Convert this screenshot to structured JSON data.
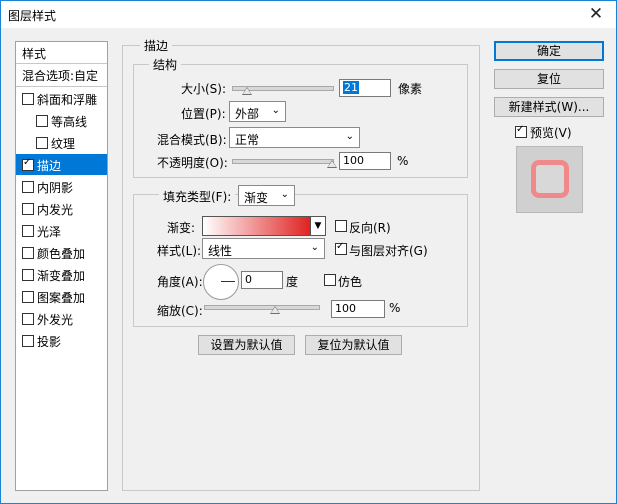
{
  "window": {
    "title": "图层样式",
    "close_glyph": "✕"
  },
  "sidebar": {
    "header": "样式",
    "blend_options": "混合选项:自定",
    "items": [
      {
        "label": "斜面和浮雕",
        "checked": false
      },
      {
        "label": "等高线",
        "checked": false
      },
      {
        "label": "纹理",
        "checked": false
      },
      {
        "label": "描边",
        "checked": true
      },
      {
        "label": "内阴影",
        "checked": false
      },
      {
        "label": "内发光",
        "checked": false
      },
      {
        "label": "光泽",
        "checked": false
      },
      {
        "label": "颜色叠加",
        "checked": false
      },
      {
        "label": "渐变叠加",
        "checked": false
      },
      {
        "label": "图案叠加",
        "checked": false
      },
      {
        "label": "外发光",
        "checked": false
      },
      {
        "label": "投影",
        "checked": false
      }
    ]
  },
  "stroke": {
    "title": "描边",
    "structure_title": "结构",
    "size_label": "大小(S):",
    "size_value": "21",
    "size_unit": "像素",
    "size_level": 0.15,
    "position_label": "位置(P):",
    "position_value": "外部",
    "blend_label": "混合模式(B):",
    "blend_value": "正常",
    "opacity_label": "不透明度(O):",
    "opacity_value": "100",
    "opacity_unit": "%",
    "opacity_level": 1.0
  },
  "fill": {
    "type_label": "填充类型(F):",
    "type_value": "渐变",
    "gradient_label": "渐变:",
    "reverse_label": "反向(R)",
    "style_label": "样式(L):",
    "style_value": "线性",
    "align_label": "与图层对齐(G)",
    "angle_label": "角度(A):",
    "angle_value": "0",
    "angle_unit": "度",
    "dither_label": "仿色",
    "scale_label": "缩放(C):",
    "scale_value": "100",
    "scale_unit": "%",
    "scale_level": 0.5,
    "reverse_checked": false,
    "align_checked": true,
    "dither_checked": false
  },
  "footer": {
    "set_default": "设置为默认值",
    "reset_default": "复位为默认值"
  },
  "actions": {
    "ok": "确定",
    "reset": "复位",
    "new_style": "新建样式(W)...",
    "preview": "预览(V)",
    "preview_checked": true
  },
  "colors": {
    "accent": "#0078d7",
    "gradient_start": "#ffffff",
    "gradient_end": "#e02020"
  }
}
